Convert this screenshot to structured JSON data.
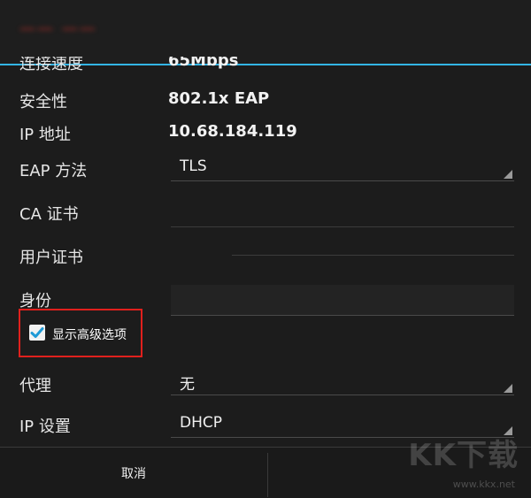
{
  "dialog": {
    "title": "—— ——",
    "rows": {
      "link_speed": {
        "label": "连接速度",
        "value": "65Mbps"
      },
      "security": {
        "label": "安全性",
        "value": "802.1x EAP"
      },
      "ip_address": {
        "label": "IP 地址",
        "value": "10.68.184.119"
      },
      "eap_method": {
        "label": "EAP 方法",
        "value": "TLS"
      },
      "ca_cert": {
        "label": "CA 证书"
      },
      "user_cert": {
        "label": "用户证书"
      },
      "identity": {
        "label": "身份"
      },
      "show_advanced": {
        "label": "显示高级选项",
        "checked": true
      },
      "proxy": {
        "label": "代理",
        "value": "无"
      },
      "ip_settings": {
        "label": "IP 设置",
        "value": "DHCP"
      }
    },
    "buttons": {
      "cancel": "取消"
    }
  },
  "watermark": {
    "logo": "KK下载",
    "url": "www.kkx.net"
  },
  "colors": {
    "accent": "#33b5e5",
    "highlight_box": "#e0201d",
    "background": "#1c1c1c"
  }
}
